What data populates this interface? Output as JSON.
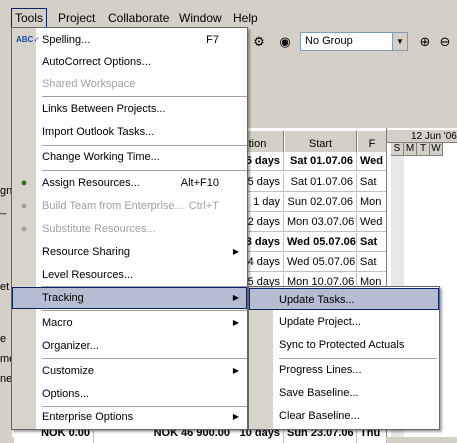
{
  "menubar": {
    "items": [
      "Tools",
      "Project",
      "Collaborate",
      "Window",
      "Help"
    ]
  },
  "toolbar": {
    "group_value": "No Group"
  },
  "table": {
    "headers": [
      "tion",
      "Start",
      "F"
    ],
    "rows": [
      {
        "dur": "5 days",
        "start": "Sat 01.07.06",
        "fin": "Wed",
        "bold": true
      },
      {
        "dur": "5 days",
        "start": "Sat 01.07.06",
        "fin": "Sat",
        "bold": false
      },
      {
        "dur": "1 day",
        "start": "Sun 02.07.06",
        "fin": "Mon",
        "bold": false
      },
      {
        "dur": "2 days",
        "start": "Mon 03.07.06",
        "fin": "Wed",
        "bold": false
      },
      {
        "dur": "3 days",
        "start": "Wed 05.07.06",
        "fin": "Sat",
        "bold": true
      },
      {
        "dur": "4 days",
        "start": "Wed 05.07.06",
        "fin": "Sat",
        "bold": false
      },
      {
        "dur": "5 days",
        "start": "Mon 10.07.06",
        "fin": "Mon",
        "bold": false
      },
      {
        "dur": "3 days",
        "start": "Wed 19.07.06",
        "fin": "Sat",
        "bold": false
      }
    ],
    "bottom_row": {
      "cost": "NOK 0.00",
      "total": "NOK 46 900.00",
      "dur": "10 days",
      "start": "Sun 23.07.06",
      "fin": "Thu"
    }
  },
  "gantt": {
    "week_label": "12 Jun '06",
    "days": [
      "S",
      "M",
      "T",
      "W"
    ]
  },
  "tools_menu": {
    "items": [
      {
        "label": "Spelling...",
        "key": "F7",
        "icon": "spelling-icon",
        "disabled": false
      },
      {
        "label": "AutoCorrect Options...",
        "key": "",
        "icon": "",
        "disabled": false
      },
      {
        "label": "Shared Workspace",
        "key": "",
        "icon": "",
        "disabled": true
      },
      {
        "label": "Links Between Projects...",
        "key": "",
        "icon": "",
        "disabled": false
      },
      {
        "label": "Import Outlook Tasks...",
        "key": "",
        "icon": "",
        "disabled": false
      },
      {
        "label": "Change Working Time...",
        "key": "",
        "icon": "",
        "disabled": false
      },
      {
        "label": "Assign Resources...",
        "key": "Alt+F10",
        "icon": "assign-resources-icon",
        "disabled": false
      },
      {
        "label": "Build Team from Enterprise...",
        "key": "Ctrl+T",
        "icon": "build-team-icon",
        "disabled": true
      },
      {
        "label": "Substitute Resources...",
        "key": "",
        "icon": "substitute-resources-icon",
        "disabled": true
      },
      {
        "label": "Resource Sharing",
        "key": "",
        "icon": "",
        "disabled": false,
        "submenu": true
      },
      {
        "label": "Level Resources...",
        "key": "",
        "icon": "",
        "disabled": false
      },
      {
        "label": "Tracking",
        "key": "",
        "icon": "",
        "disabled": false,
        "submenu": true
      },
      {
        "label": "Macro",
        "key": "",
        "icon": "",
        "disabled": false,
        "submenu": true
      },
      {
        "label": "Organizer...",
        "key": "",
        "icon": "",
        "disabled": false
      },
      {
        "label": "Customize",
        "key": "",
        "icon": "",
        "disabled": false,
        "submenu": true
      },
      {
        "label": "Options...",
        "key": "",
        "icon": "",
        "disabled": false
      },
      {
        "label": "Enterprise Options",
        "key": "",
        "icon": "",
        "disabled": false,
        "submenu": true
      }
    ]
  },
  "tracking_menu": {
    "items": [
      "Update Tasks...",
      "Update Project...",
      "Sync to Protected Actuals",
      "Progress Lines...",
      "Save Baseline...",
      "Clear Baseline..."
    ]
  }
}
